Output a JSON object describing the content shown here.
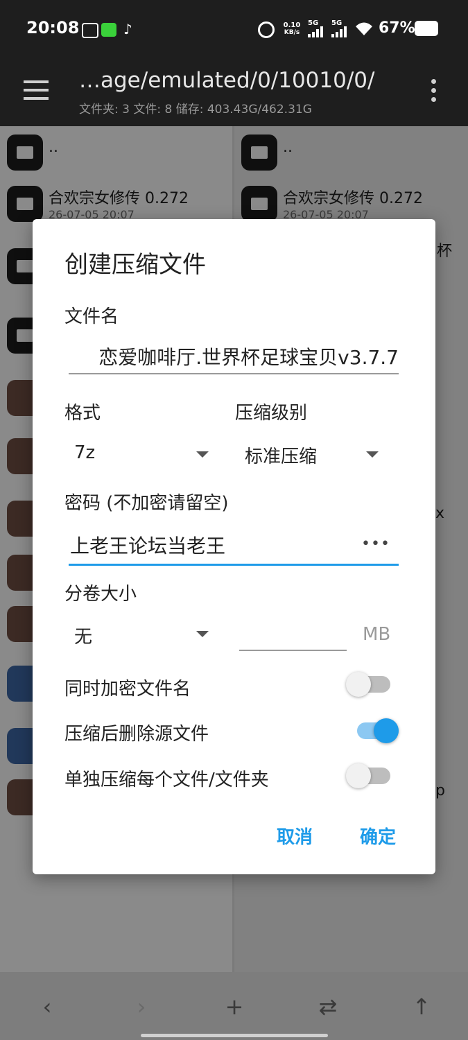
{
  "status": {
    "time": "20:08",
    "net_speed_top": "0.10",
    "net_speed_unit": "KB/s",
    "signal1": "5G",
    "signal2": "5G",
    "battery": "67%"
  },
  "appbar": {
    "path": "…age/emulated/0/10010/0/",
    "info": "文件夹: 3  文件: 8  储存: 403.43G/462.31G"
  },
  "left_pane": {
    "parent": "..",
    "item1_name": "合欢宗女修传 0.272",
    "item1_date": "26-07-05 20:07"
  },
  "right_pane": {
    "parent": "..",
    "item1_name": "合欢宗女修传 0.272",
    "item1_date": "26-07-05 20:07",
    "frag_cup": "杯",
    "frag_x": "x",
    "frag_p": "p"
  },
  "dialog": {
    "title": "创建压缩文件",
    "filename_label": "文件名",
    "filename_value": "恋爱咖啡厅.世界杯足球宝贝v3.7.7",
    "format_label": "格式",
    "format_value": "7z",
    "level_label": "压缩级别",
    "level_value": "标准压缩",
    "password_label": "密码 (不加密请留空)",
    "password_value": "上老王论坛当老王",
    "volume_label": "分卷大小",
    "volume_value": "无",
    "volume_unit": "MB",
    "toggle1_label": "同时加密文件名",
    "toggle1_on": false,
    "toggle2_label": "压缩后删除源文件",
    "toggle2_on": true,
    "toggle3_label": "单独压缩每个文件/文件夹",
    "toggle3_on": false,
    "cancel": "取消",
    "confirm": "确定"
  },
  "colors": {
    "accent": "#1e9be9",
    "toggle_on_track": "#8cc8f2",
    "toggle_off_track": "#bdbdbd",
    "toggle_off_knob": "#f1f1f1"
  }
}
